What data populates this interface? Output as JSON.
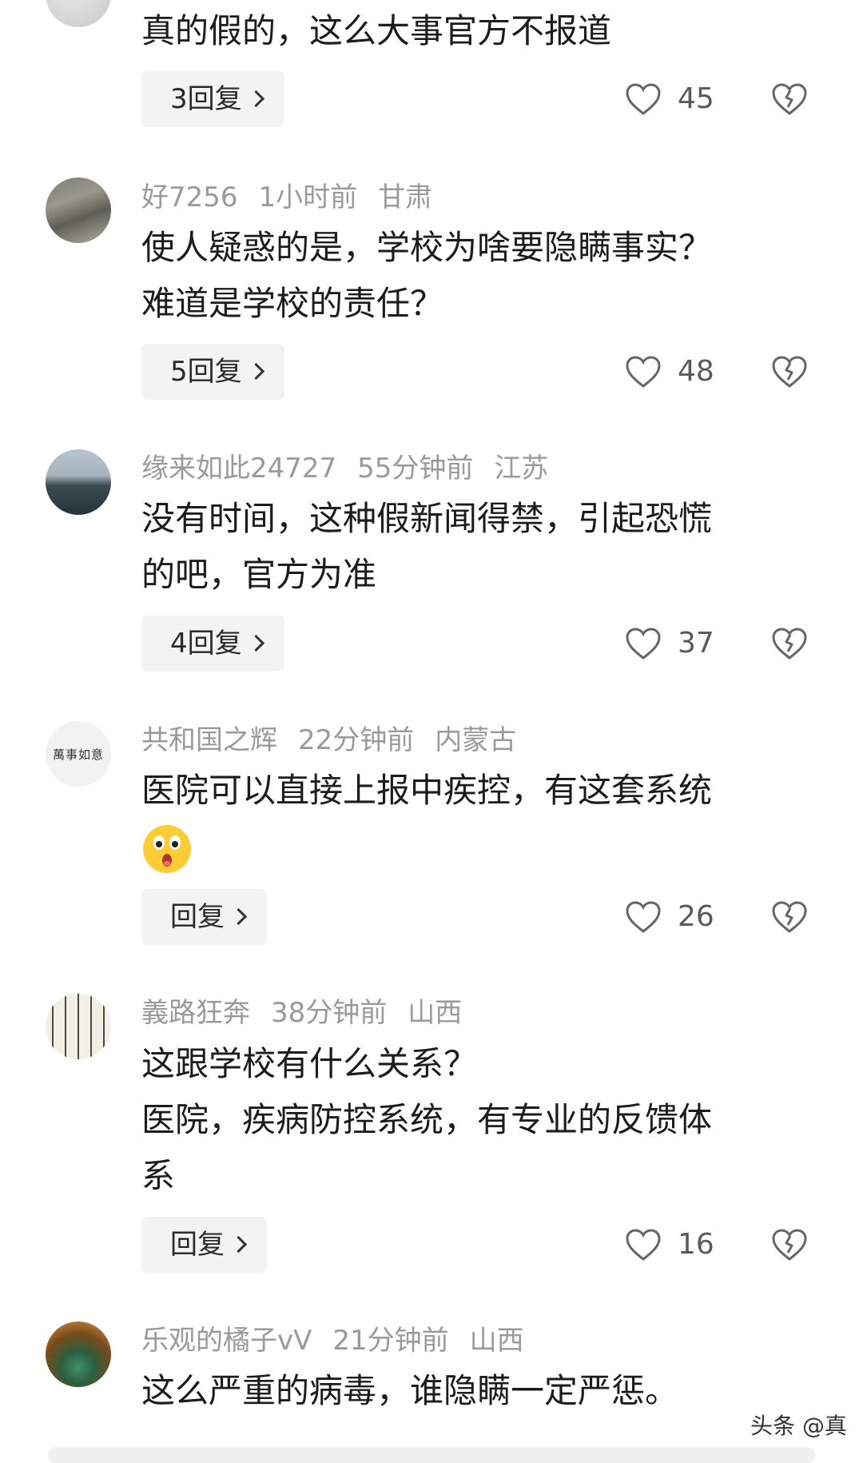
{
  "comments": [
    {
      "author": "",
      "time": "",
      "location": "",
      "lines": [
        "真的假的，这么大事官方不报道"
      ],
      "reply_label": "3回复",
      "likes": "45"
    },
    {
      "author": "好7256",
      "time": "1小时前",
      "location": "甘肃",
      "lines": [
        "使人疑惑的是，学校为啥要隐瞒事实？",
        "难道是学校的责任？"
      ],
      "reply_label": "5回复",
      "likes": "48"
    },
    {
      "author": "缘来如此24727",
      "time": "55分钟前",
      "location": "江苏",
      "lines": [
        "没有时间，这种假新闻得禁，引起恐慌",
        "的吧，官方为准"
      ],
      "reply_label": "4回复",
      "likes": "37"
    },
    {
      "author": "共和国之辉",
      "time": "22分钟前",
      "location": "内蒙古",
      "lines": [
        "医院可以直接上报中疾控，有这套系统"
      ],
      "emoji": "astonished-face-icon",
      "reply_label": "回复",
      "likes": "26"
    },
    {
      "author": "義路狂奔",
      "time": "38分钟前",
      "location": "山西",
      "lines": [
        "这跟学校有什么关系？",
        "医院，疾病防控系统，有专业的反馈体",
        "系"
      ],
      "reply_label": "回复",
      "likes": "16"
    },
    {
      "author": "乐观的橘子vV",
      "time": "21分钟前",
      "location": "山西",
      "lines": [
        "这么严重的病毒，谁隐瞒一定严惩。"
      ]
    }
  ],
  "avatars": {
    "avatar_4_text": "萬事如意"
  },
  "watermark": "头条 @真",
  "icons": {
    "like": "heart-outline-icon",
    "dislike": "broken-heart-icon",
    "chevron": "chevron-right-icon"
  },
  "colors": {
    "meta_text": "#9a9a9a",
    "body_text": "#1c1c1c",
    "reply_bg": "#f3f3f3",
    "icon_stroke": "#666666"
  }
}
